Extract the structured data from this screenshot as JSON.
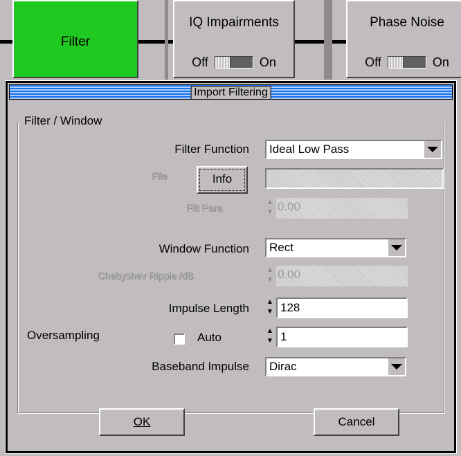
{
  "blocks": {
    "filter": {
      "title": "Filter"
    },
    "iq": {
      "title": "IQ Impairments",
      "off": "Off",
      "on": "On"
    },
    "phase": {
      "title": "Phase Noise",
      "off": "Off",
      "on": "On"
    }
  },
  "dialog": {
    "title": "Import Filtering",
    "group_label": "Filter / Window",
    "filter_function": {
      "label": "Filter Function",
      "value": "Ideal Low Pass"
    },
    "file": {
      "label": "File",
      "info_button": "Info",
      "value": ""
    },
    "filt_para": {
      "label": "Filt Para",
      "value": "0.00"
    },
    "window_function": {
      "label": "Window Function",
      "value": "Rect"
    },
    "chebyshev": {
      "label": "Chebyshev Ripple /dB",
      "value": "0.00"
    },
    "impulse_length": {
      "label": "Impulse Length",
      "value": "128"
    },
    "oversampling": {
      "label": "Oversampling",
      "auto_label": "Auto",
      "auto_checked": false,
      "value": "1"
    },
    "baseband_impulse": {
      "label": "Baseband Impulse",
      "value": "Dirac"
    },
    "ok_label": "OK",
    "cancel_label": "Cancel"
  },
  "colors": {
    "active_block": "#1fc91f",
    "background": "#c0bcc0",
    "titlebar": "#1c72e8"
  }
}
